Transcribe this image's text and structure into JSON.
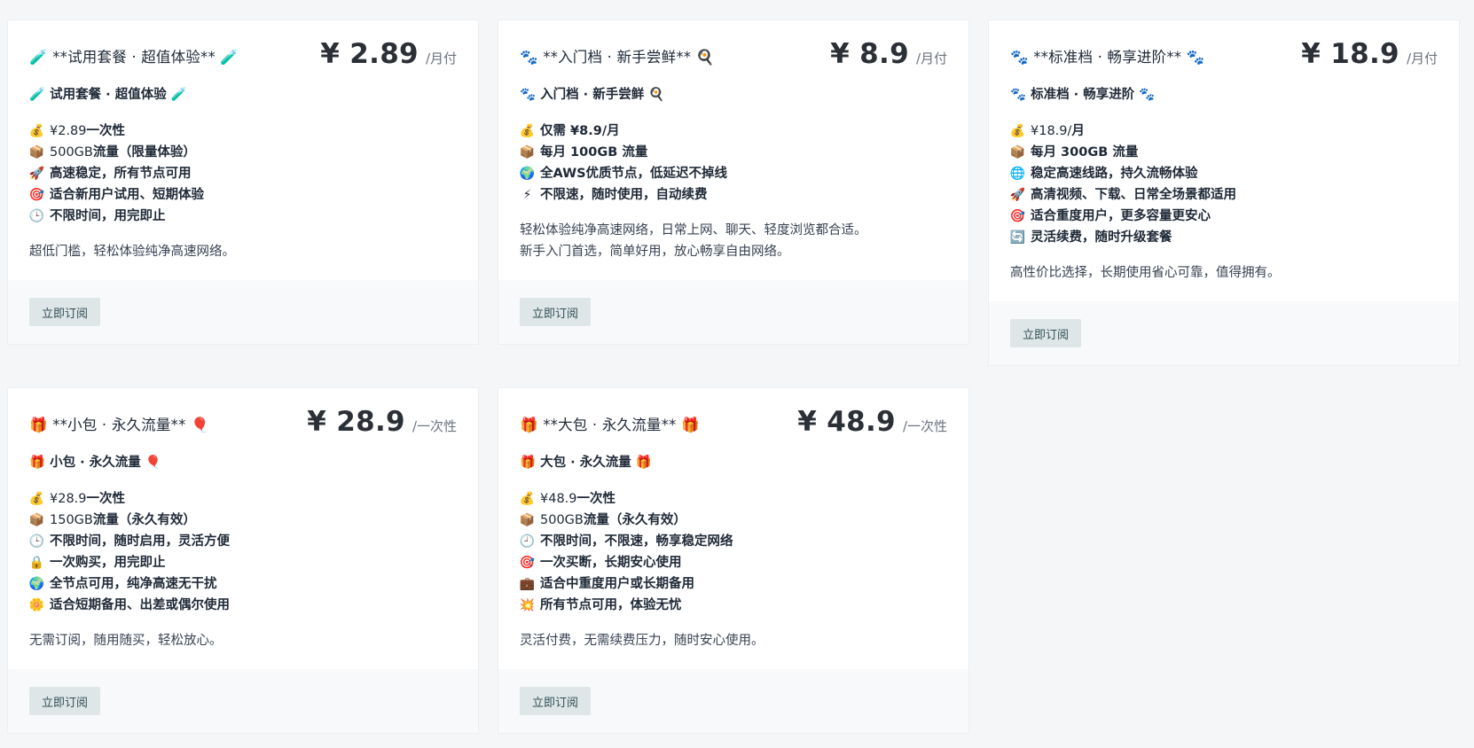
{
  "cards": [
    {
      "title": "🧪 **试用套餐 · 超值体验** 🧪",
      "price": "¥ 2.89",
      "unit": "/月付",
      "subtitle": "🧪 试用套餐 · 超值体验 🧪",
      "features": [
        {
          "icon": "💰",
          "pre": "¥2.89 ",
          "text": "一次性"
        },
        {
          "icon": "📦",
          "pre": "500GB ",
          "text": "流量（限量体验）"
        },
        {
          "icon": "🚀",
          "pre": "",
          "text": "高速稳定，所有节点可用"
        },
        {
          "icon": "🎯",
          "pre": "",
          "text": "适合新用户试用、短期体验"
        },
        {
          "icon": "🕒",
          "pre": "",
          "text": "不限时间，用完即止"
        }
      ],
      "desc": [
        "超低门槛，轻松体验纯净高速网络。"
      ],
      "button": "立即订阅"
    },
    {
      "title": "🐾 **入门档 · 新手尝鲜** 🍳",
      "price": "¥ 8.9",
      "unit": "/月付",
      "subtitle": "🐾 入门档 · 新手尝鲜 🍳",
      "features": [
        {
          "icon": "💰",
          "pre": "",
          "text": "仅需 ¥8.9/月"
        },
        {
          "icon": "📦",
          "pre": "",
          "text": "每月 100GB 流量"
        },
        {
          "icon": "🌍",
          "pre": "",
          "text": "全AWS优质节点，低延迟不掉线"
        },
        {
          "icon": "⚡",
          "pre": "",
          "text": "不限速，随时使用，自动续费"
        }
      ],
      "desc": [
        "轻松体验纯净高速网络，日常上网、聊天、轻度浏览都合适。",
        "新手入门首选，简单好用，放心畅享自由网络。"
      ],
      "button": "立即订阅"
    },
    {
      "title": "🐾 **标准档 · 畅享进阶** 🐾",
      "price": "¥ 18.9",
      "unit": "/月付",
      "subtitle": "🐾 标准档 · 畅享进阶 🐾",
      "features": [
        {
          "icon": "💰",
          "pre": "¥18.9/",
          "text": "月"
        },
        {
          "icon": "📦",
          "pre": "",
          "text": "每月 300GB 流量"
        },
        {
          "icon": "🌐",
          "pre": "",
          "text": "稳定高速线路，持久流畅体验"
        },
        {
          "icon": "🚀",
          "pre": "",
          "text": "高清视频、下载、日常全场景都适用"
        },
        {
          "icon": "🎯",
          "pre": "",
          "text": "适合重度用户，更多容量更安心"
        },
        {
          "icon": "🔄",
          "pre": "",
          "text": "灵活续费，随时升级套餐"
        }
      ],
      "desc": [
        "高性价比选择，长期使用省心可靠，值得拥有。"
      ],
      "button": "立即订阅"
    },
    {
      "title": "🎁 **小包 · 永久流量** 🎈",
      "price": "¥ 28.9",
      "unit": "/一次性",
      "subtitle": "🎁 小包 · 永久流量 🎈",
      "features": [
        {
          "icon": "💰",
          "pre": "¥28.9 ",
          "text": "一次性"
        },
        {
          "icon": "📦",
          "pre": "150GB ",
          "text": "流量（永久有效）"
        },
        {
          "icon": "🕒",
          "pre": "",
          "text": "不限时间，随时启用，灵活方便"
        },
        {
          "icon": "🔒",
          "pre": "",
          "text": "一次购买，用完即止"
        },
        {
          "icon": "🌍",
          "pre": "",
          "text": "全节点可用，纯净高速无干扰"
        },
        {
          "icon": "🌼",
          "pre": "",
          "text": "适合短期备用、出差或偶尔使用"
        }
      ],
      "desc": [
        "无需订阅，随用随买，轻松放心。"
      ],
      "button": "立即订阅"
    },
    {
      "title": "🎁 **大包 · 永久流量** 🎁",
      "price": "¥ 48.9",
      "unit": "/一次性",
      "subtitle": "🎁 大包 · 永久流量 🎁",
      "features": [
        {
          "icon": "💰",
          "pre": "¥48.9 ",
          "text": "一次性"
        },
        {
          "icon": "📦",
          "pre": "500GB ",
          "text": "流量（永久有效）"
        },
        {
          "icon": "🕘",
          "pre": "",
          "text": "不限时间，不限速，畅享稳定网络"
        },
        {
          "icon": "🎯",
          "pre": "",
          "text": "一次买断，长期安心使用"
        },
        {
          "icon": "💼",
          "pre": "",
          "text": "适合中重度用户或长期备用"
        },
        {
          "icon": "💥",
          "pre": "",
          "text": "所有节点可用，体验无忧"
        }
      ],
      "desc": [
        "灵活付费，无需续费压力，随时安心使用。"
      ],
      "button": "立即订阅"
    }
  ]
}
